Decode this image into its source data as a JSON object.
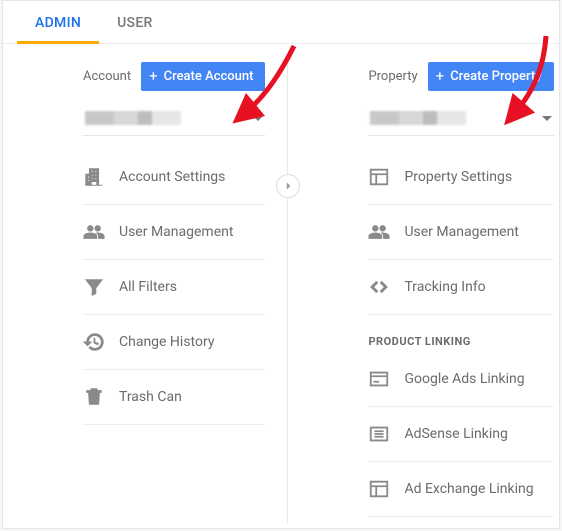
{
  "tabs": {
    "admin": "ADMIN",
    "user": "USER"
  },
  "account": {
    "col_label": "Account",
    "create_label": "Create Account",
    "items": [
      {
        "label": "Account Settings"
      },
      {
        "label": "User Management"
      },
      {
        "label": "All Filters"
      },
      {
        "label": "Change History"
      },
      {
        "label": "Trash Can"
      }
    ]
  },
  "property": {
    "col_label": "Property",
    "create_label": "Create Property",
    "items": [
      {
        "label": "Property Settings"
      },
      {
        "label": "User Management"
      },
      {
        "label": "Tracking Info"
      }
    ],
    "product_linking_heading": "PRODUCT LINKING",
    "product_linking": [
      {
        "label": "Google Ads Linking"
      },
      {
        "label": "AdSense Linking"
      },
      {
        "label": "Ad Exchange Linking"
      }
    ]
  }
}
